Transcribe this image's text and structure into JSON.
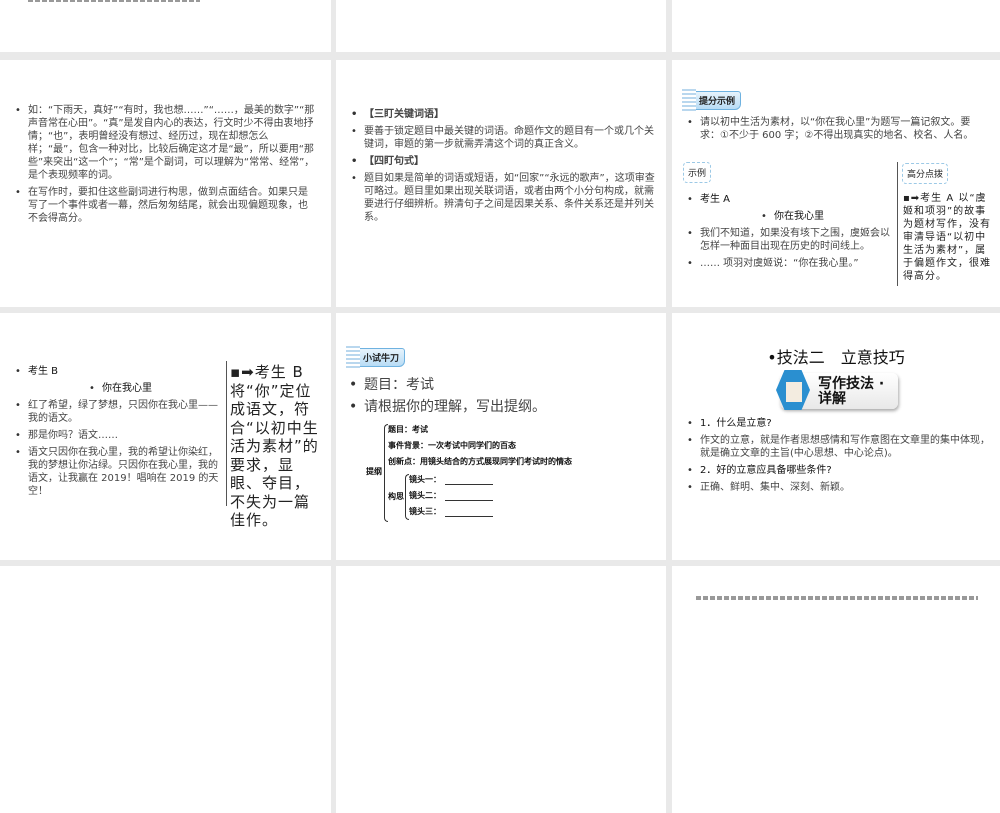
{
  "slides": {
    "s1": {
      "bullets": [
        "如：“下雨天，真好”“有时，我也想……”“……，最美的数字”“那声音常在心田”。“真”是发自内心的表达，行文时少不得由衷地抒情；“也”，表明曾经没有想过、经历过，现在却想怎么样；“最”，包含一种对比，比较后确定这才是“最”，所以要用“那些”来突出“这一个”；“常”是个副词，可以理解为“常常、经常”，是个表现频率的词。",
        "在写作时，要扣住这些副词进行构思，做到点面结合。如果只是写了一个事件或者一幕，然后匆匆结尾，就会出现偏题现象，也不会得高分。"
      ]
    },
    "s2": {
      "bullets": [
        "【三盯关键词语】",
        "要善于锁定题目中最关键的词语。命题作文的题目有一个或几个关键词，审题的第一步就需弄清这个词的真正含义。",
        "【四盯句式】",
        "题目如果是简单的词语或短语，如“回家”“永远的歌声”，这项审查可略过。题目里如果出现关联词语，或者由两个小分句构成，就需要进行仔细辨析。辨清句子之间是因果关系、条件关系还是并列关系。"
      ]
    },
    "s3": {
      "badge": "提分示例",
      "prompt": "请以初中生活为素材，以“你在我心里”为题写一篇记叙文。要求：①不少于 600 字；②不得出现真实的地名、校名、人名。",
      "example_label": "示例",
      "tips_label": "高分点拨",
      "student": "考生 A",
      "title": "你在我心里",
      "lines": [
        "我们不知道，如果没有垓下之围，虞姬会以怎样一种面目出现在历史的时间线上。",
        "…… 项羽对虞姬说：“你在我心里。”"
      ],
      "comment": "考生 A 以“虞姬和项羽”的故事为题材写作，没有审清导语“以初中生活为素材”，属于偏题作文，很难得高分。"
    },
    "s4": {
      "student": "考生 B",
      "title": "你在我心里",
      "lines": [
        "红了希望，绿了梦想，只因你在我心里——我的语文。",
        "那是你吗？语文……",
        "语文只因你在我心里，我的希望让你染红，我的梦想让你沾绿。只因你在我心里，我的语文，让我赢在 2019！唱响在 2019 的天空！"
      ],
      "comment": "考生 B 将“你”定位成语文，符合“以初中生活为素材”的要求，显眼、夺目，不失为一篇佳作。"
    },
    "s5": {
      "badge": "小试牛刀",
      "bullets": [
        "题目：考试",
        "请根据你的理解，写出提纲。"
      ],
      "outline": {
        "root": "提纲",
        "items": [
          "题目：考试",
          "事件背景：一次考试中同学们的百态",
          "创新点：用镜头结合的方式展现同学们考试时的情态"
        ],
        "plan": "构思",
        "shots": [
          "镜头一：",
          "镜头二：",
          "镜头三："
        ]
      }
    },
    "s6": {
      "title": "•技法二　立意技巧",
      "badge": "写作技法 ·详解",
      "bullets": [
        "1．什么是立意?",
        "作文的立意，就是作者思想感情和写作意图在文章里的集中体现，就是确立文章的主旨(中心思想、中心论点)。",
        "2．好的立意应具备哪些条件?",
        "正确、鲜明、集中、深刻、新颖。"
      ]
    }
  }
}
